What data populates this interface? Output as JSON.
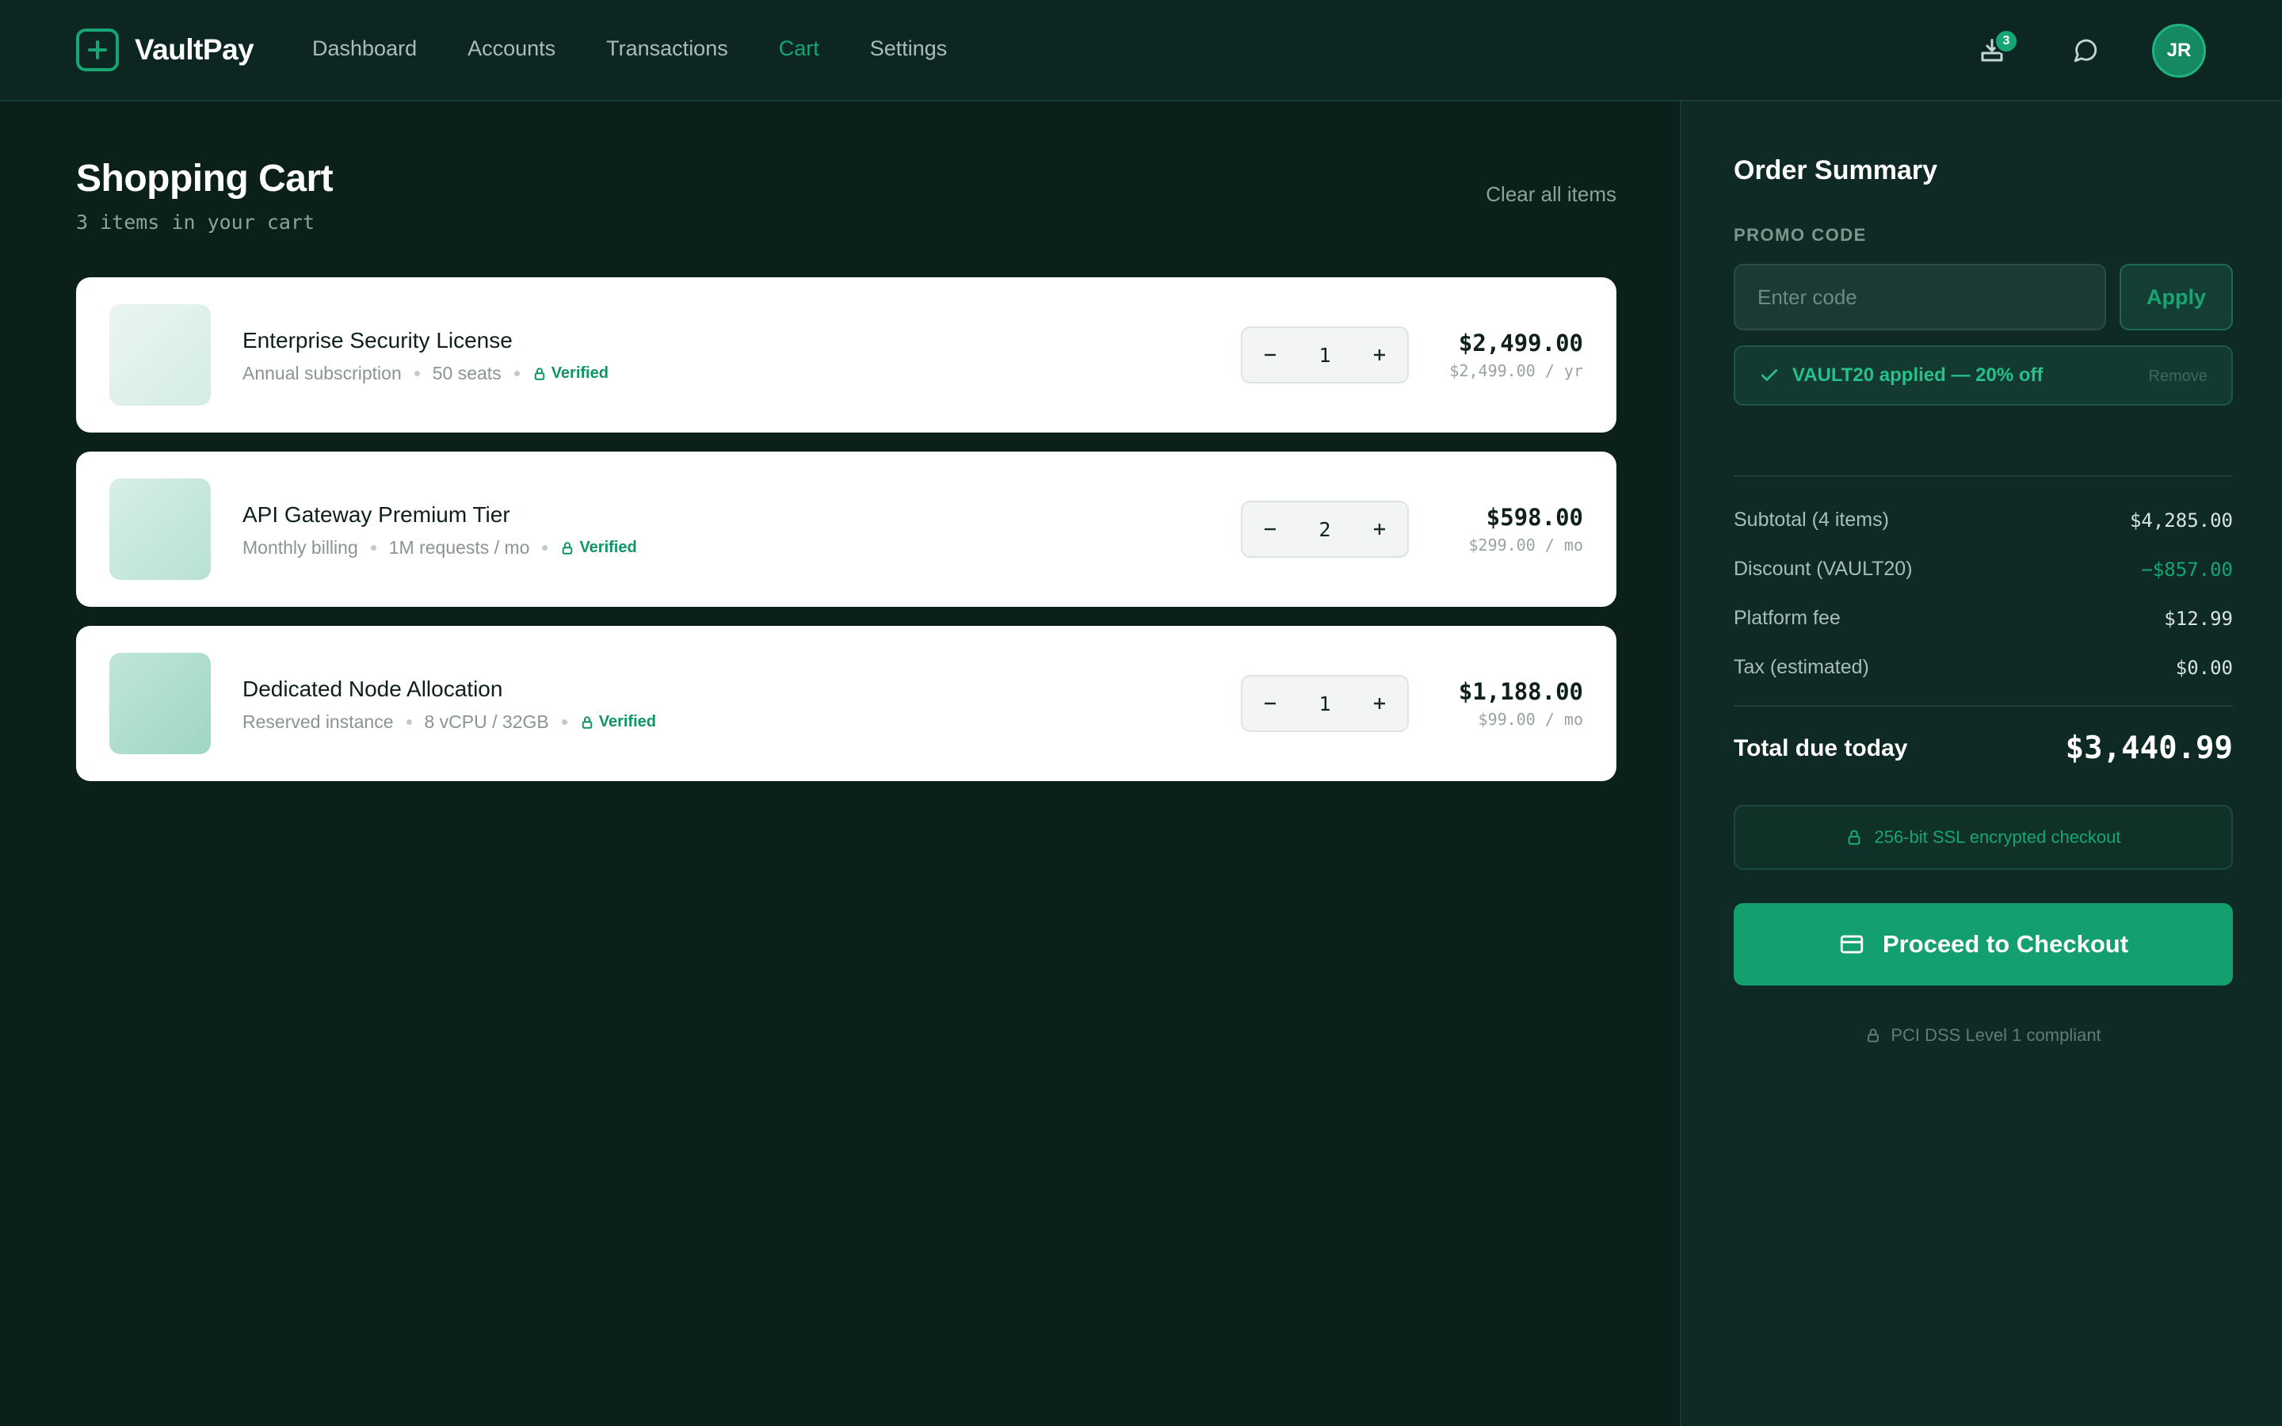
{
  "app": {
    "name": "VaultPay"
  },
  "nav": {
    "items": [
      {
        "label": "Dashboard",
        "active": false
      },
      {
        "label": "Accounts",
        "active": false
      },
      {
        "label": "Transactions",
        "active": false
      },
      {
        "label": "Cart",
        "active": true
      },
      {
        "label": "Settings",
        "active": false
      }
    ]
  },
  "header": {
    "notification_count": "3",
    "user_initials": "JR"
  },
  "cart": {
    "title": "Shopping Cart",
    "subtitle": "3 items in your cart",
    "clear_label": "Clear all items",
    "items": [
      {
        "name": "Enterprise Security License",
        "meta": [
          "Annual subscription",
          "50 seats"
        ],
        "verified": "Verified",
        "quantity": "1",
        "price": "$2,499.00",
        "unit_price": "$2,499.00 / yr"
      },
      {
        "name": "API Gateway Premium Tier",
        "meta": [
          "Monthly billing",
          "1M requests / mo"
        ],
        "verified": "Verified",
        "quantity": "2",
        "price": "$598.00",
        "unit_price": "$299.00 / mo"
      },
      {
        "name": "Dedicated Node Allocation",
        "meta": [
          "Reserved instance",
          "8 vCPU / 32GB"
        ],
        "verified": "Verified",
        "quantity": "1",
        "price": "$1,188.00",
        "unit_price": "$99.00 / mo"
      }
    ]
  },
  "summary": {
    "title": "Order Summary",
    "promo_label": "PROMO CODE",
    "promo_placeholder": "Enter code",
    "promo_value": "",
    "apply_label": "Apply",
    "applied_text": "VAULT20 applied — 20% off",
    "remove_label": "Remove",
    "rows": [
      {
        "label": "Subtotal (4 items)",
        "value": "$4,285.00"
      },
      {
        "label": "Discount (VAULT20)",
        "value": "−$857.00"
      },
      {
        "label": "Platform fee",
        "value": "$12.99"
      },
      {
        "label": "Tax (estimated)",
        "value": "$0.00"
      }
    ],
    "total_label": "Total due today",
    "total_value": "$3,440.99",
    "ssl_text": "256-bit SSL encrypted checkout",
    "checkout_label": "Proceed to Checkout",
    "compliance_text": "PCI DSS Level 1 compliant"
  },
  "colors": {
    "accent": "#17a673",
    "background": "#0b1f1b",
    "sidebar": "#0f2a24",
    "card": "#ffffff"
  },
  "icons": [
    "plus-logo-icon",
    "cart-tray-icon",
    "chat-bubble-icon",
    "lock-icon",
    "check-icon",
    "minus-icon",
    "plus-icon",
    "card-icon"
  ]
}
